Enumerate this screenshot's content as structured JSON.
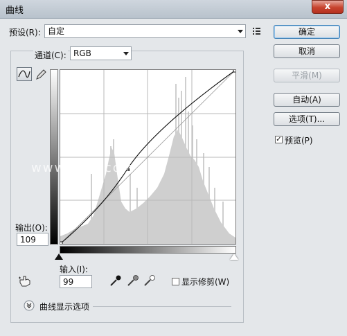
{
  "window": {
    "title": "曲线",
    "close_glyph": "x"
  },
  "preset": {
    "label": "预设(R):",
    "value": "自定"
  },
  "channel": {
    "label": "通道(C):",
    "value": "RGB"
  },
  "buttons": {
    "ok": "确定",
    "cancel": "取消",
    "smooth": "平滑(M)",
    "auto": "自动(A)",
    "options": "选项(T)..."
  },
  "preview": {
    "label": "预览(P)",
    "checked": true
  },
  "output": {
    "label": "输出(O):",
    "value": "109"
  },
  "input": {
    "label": "输入(I):",
    "value": "99"
  },
  "show_clipping": {
    "label": "显示修剪(W)",
    "checked": false
  },
  "curve_display_options": {
    "label": "曲线显示选项"
  },
  "watermark": "www.ha...com",
  "curve": {
    "input": 99,
    "output": 109
  }
}
